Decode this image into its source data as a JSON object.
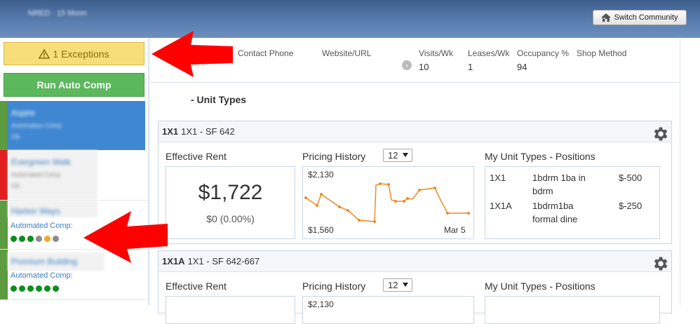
{
  "header": {
    "brand": "NRED · 15 Moon",
    "switch_label": "Switch Community"
  },
  "sidebar": {
    "exceptions_label": "1 Exceptions",
    "run_label": "Run Auto Comp",
    "communities": [
      {
        "name": "Aspire",
        "sub": "Automation Comp",
        "sub2": "OK",
        "color": "#5c9b3f",
        "selected": true
      },
      {
        "name": "Evergreen Walk",
        "sub": "Automated Comp",
        "sub2": "OK",
        "color": "#e22020"
      },
      {
        "name": "Harbor Ways",
        "ac_label": "Automated Comp:",
        "color": "#5c9b3f",
        "dots": [
          "#0a8f1c",
          "#0a8f1c",
          "#0a8f1c",
          "#8a8a8a",
          "#f5a623",
          "#8a8a8a"
        ]
      },
      {
        "name": "Premium Building",
        "ac_label": "Automated Comp:",
        "color": "#5c9b3f",
        "dots": [
          "#0a8f1c",
          "#0a8f1c",
          "#0a8f1c",
          "#0a8f1c",
          "#0a8f1c",
          "#0a8f1c"
        ]
      }
    ]
  },
  "main": {
    "header_cols": [
      "Contact Phone",
      "Website/URL",
      "Visits/Wk",
      "Leases/Wk",
      "Occupancy %",
      "Shop Method"
    ],
    "visits": "10",
    "leases": "1",
    "occupancy": "94",
    "section_title": "- Unit Types",
    "card1": {
      "code": "1X1",
      "desc": "1X1 - SF 642",
      "eff_label": "Effective Rent",
      "rent": "$1,722",
      "rent_change": "$0 (0.00%)",
      "ph_label": "Pricing History",
      "ph_select": "12",
      "ph_max": "$2,130",
      "ph_min": "$1,560",
      "ph_date": "Mar 5",
      "pos_label": "My Unit Types - Positions",
      "positions": [
        {
          "code": "1X1",
          "desc1": "1bdrm 1ba in",
          "desc2": "bdrm",
          "value": "$-500"
        },
        {
          "code": "1X1A",
          "desc1": "1bdrm1ba",
          "desc2": "formal dine",
          "value": "$-250"
        }
      ]
    },
    "card2": {
      "code": "1X1A",
      "desc": "1X1 - SF 642-667",
      "eff_label": "Effective Rent",
      "ph_label": "Pricing History",
      "ph_select": "12",
      "ph_max": "$2,130",
      "pos_label": "My Unit Types - Positions"
    }
  },
  "colors": {
    "accent": "#f08a24",
    "topbar": "#4a6c9d",
    "run": "#5cb85c",
    "warn": "#f7de7a",
    "arrow": "#ff0000"
  },
  "icons": [
    "home-icon",
    "warning-icon",
    "gear-icon",
    "arrow-circle-icon",
    "red-arrow-annotation"
  ]
}
